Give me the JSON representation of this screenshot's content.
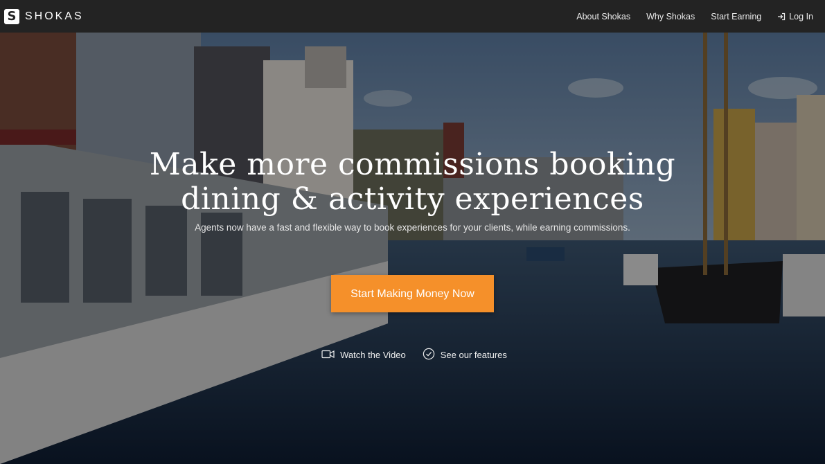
{
  "navbar": {
    "brand_letter": "S",
    "brand_name": "SHOKAS",
    "links": [
      {
        "label": "About Shokas"
      },
      {
        "label": "Why Shokas"
      },
      {
        "label": "Start Earning"
      },
      {
        "label": "Log In",
        "icon": "sign-in-icon"
      }
    ]
  },
  "hero": {
    "headline_line1": "Make more commissions booking",
    "headline_line2": "dining & activity experiences",
    "subheadline": "Agents now have a fast and flexible way to book experiences for your clients, while earning commissions.",
    "cta_label": "Start Making Money Now",
    "secondary": [
      {
        "label": "Watch the Video",
        "icon": "video-camera-icon"
      },
      {
        "label": "See our features",
        "icon": "check-circle-icon"
      }
    ],
    "background": "canal-harbor-photo"
  },
  "colors": {
    "navbar_bg": "#232323",
    "cta_bg": "#f5902a",
    "text": "#ffffff"
  }
}
